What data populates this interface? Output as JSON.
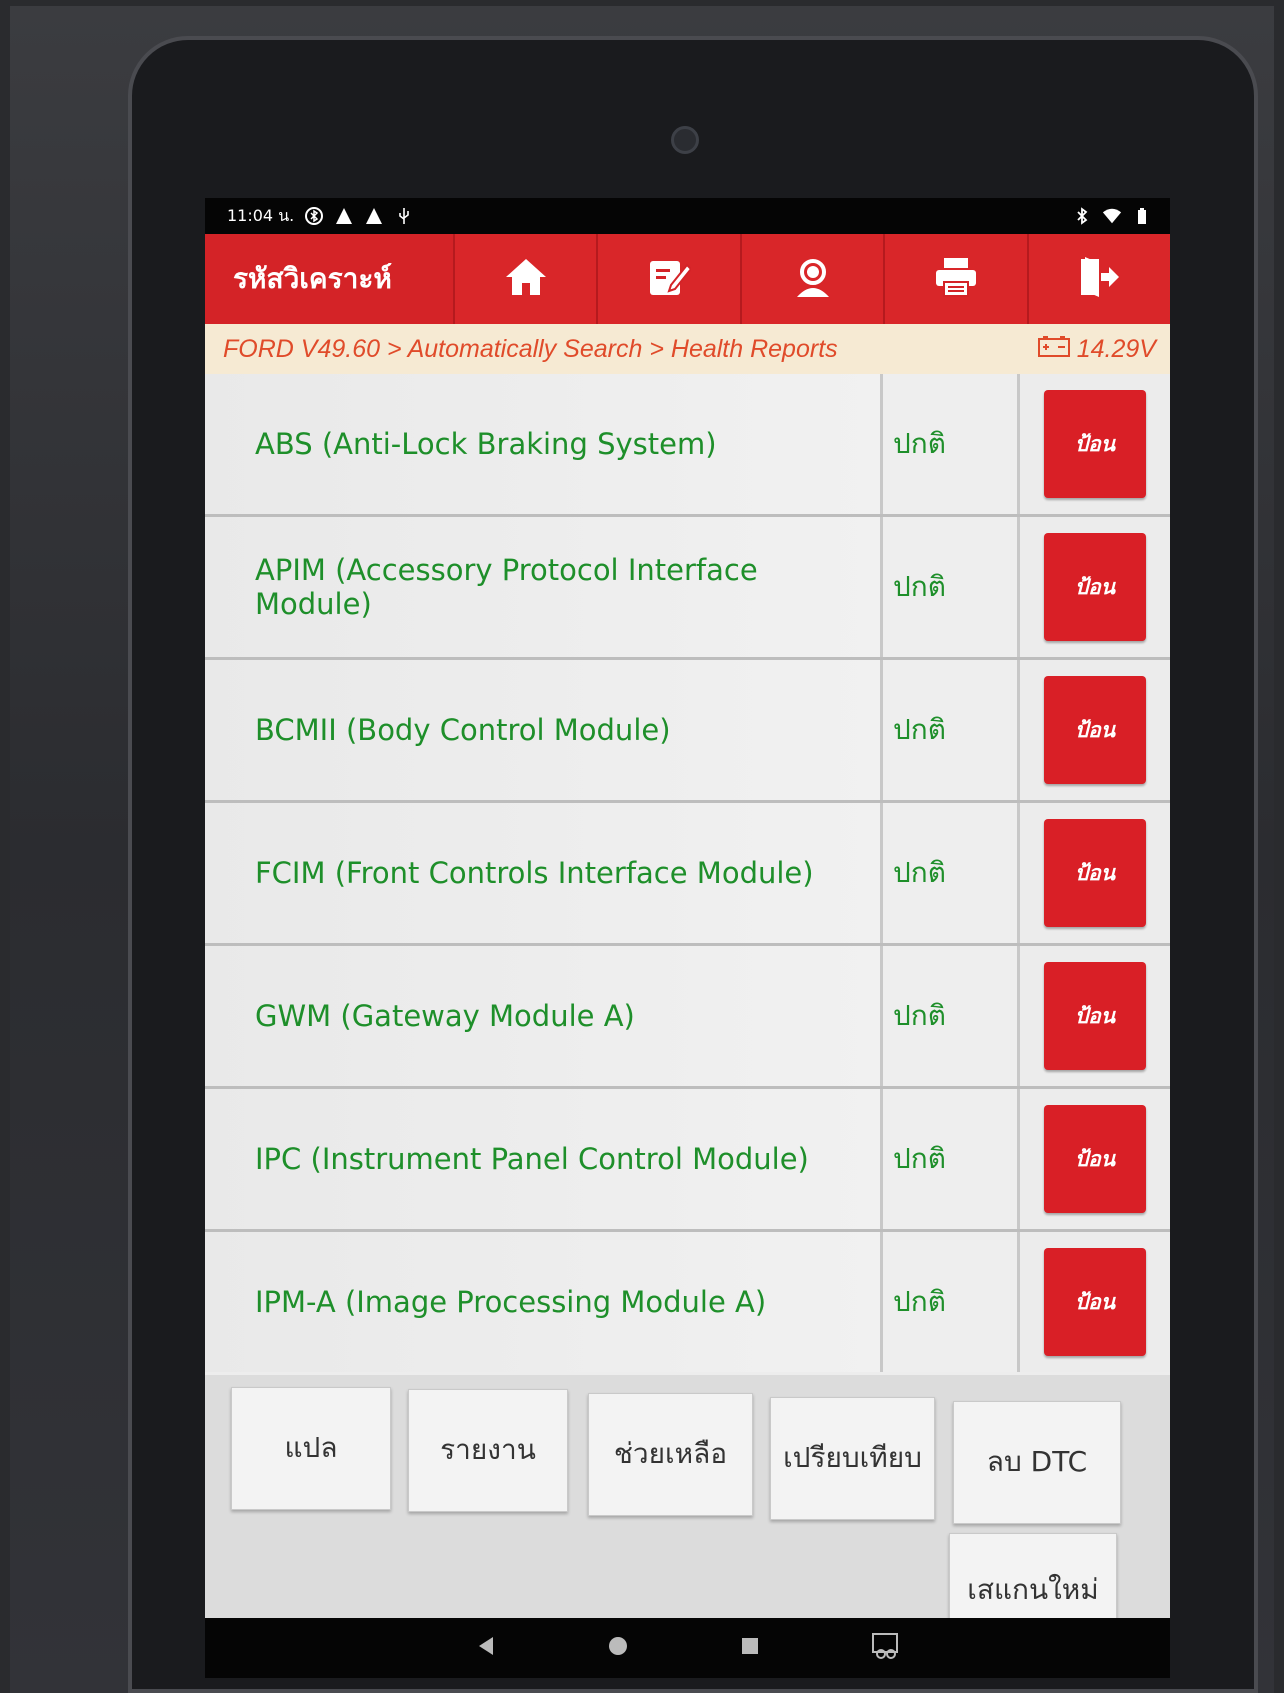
{
  "status_bar": {
    "time": "11:04 น."
  },
  "header": {
    "title": "รหัสวิเคราะห์",
    "icons": [
      "home-icon",
      "edit-icon",
      "support-icon",
      "print-icon",
      "exit-icon"
    ]
  },
  "breadcrumb": {
    "path": "FORD V49.60 > Automatically Search > Health Reports",
    "voltage": "14.29V"
  },
  "modules": [
    {
      "name": "ABS (Anti-Lock Braking System)",
      "status": "ปกติ",
      "action": "ป้อน"
    },
    {
      "name": "APIM (Accessory Protocol Interface Module)",
      "status": "ปกติ",
      "action": "ป้อน"
    },
    {
      "name": "BCMII (Body Control Module)",
      "status": "ปกติ",
      "action": "ป้อน"
    },
    {
      "name": "FCIM (Front Controls Interface Module)",
      "status": "ปกติ",
      "action": "ป้อน"
    },
    {
      "name": "GWM (Gateway Module A)",
      "status": "ปกติ",
      "action": "ป้อน"
    },
    {
      "name": "IPC (Instrument Panel Control Module)",
      "status": "ปกติ",
      "action": "ป้อน"
    },
    {
      "name": "IPM-A (Image Processing Module A)",
      "status": "ปกติ",
      "action": "ป้อน"
    }
  ],
  "actions": {
    "translate": "แปล",
    "report": "รายงาน",
    "help": "ช่วยเหลือ",
    "compare": "เปรียบเทียบ",
    "clear_dtc": "ลบ DTC",
    "rescan": "เสแกนใหม่"
  },
  "colors": {
    "header_red": "#d42327",
    "module_green": "#1e8f2a",
    "breadcrumb_orange": "#e04b2a"
  }
}
